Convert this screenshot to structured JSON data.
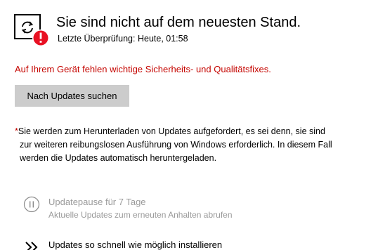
{
  "status": {
    "title": "Sie sind nicht auf dem neuesten Stand.",
    "last_check": "Letzte Überprüfung: Heute, 01:58",
    "icon": "sync-icon",
    "badge_icon": "error-badge-icon",
    "warning": "Auf Ihrem Gerät fehlen wichtige Sicherheits- und Qualitätsfixes."
  },
  "actions": {
    "check_button_label": "Nach Updates suchen"
  },
  "note": {
    "asterisk": "*",
    "line1": "Sie werden zum Herunterladen von Updates aufgefordert, es sei denn, sie sind",
    "line2": "zur weiteren reibungslosen Ausführung von Windows erforderlich. In diesem Fall",
    "line3": "werden die Updates automatisch heruntergeladen."
  },
  "options": [
    {
      "icon": "pause-icon",
      "title": "Updatepause für 7 Tage",
      "subtitle": "Aktuelle Updates zum erneuten Anhalten abrufen",
      "enabled": false
    },
    {
      "icon": "fast-forward-icon",
      "title": "Updates so schnell wie möglich installieren",
      "enabled": true
    }
  ],
  "colors": {
    "warning": "#c50500",
    "button_bg": "#cccccc",
    "disabled_text": "#9a9a9a",
    "badge": "#e81123"
  }
}
